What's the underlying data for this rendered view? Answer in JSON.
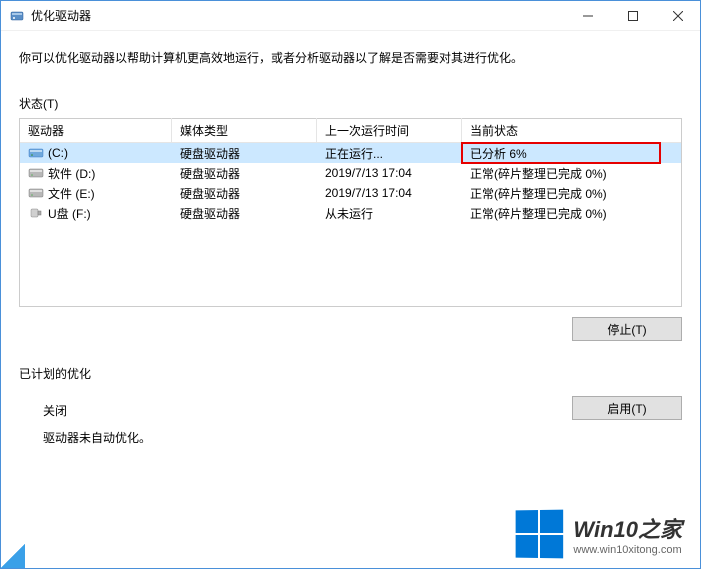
{
  "window": {
    "title": "优化驱动器"
  },
  "description": "你可以优化驱动器以帮助计算机更高效地运行，或者分析驱动器以了解是否需要对其进行优化。",
  "status": {
    "label": "状态(T)"
  },
  "columns": {
    "drive": "驱动器",
    "media": "媒体类型",
    "lastRun": "上一次运行时间",
    "state": "当前状态"
  },
  "drives": [
    {
      "icon": "disk-c",
      "name": "(C:)",
      "media": "硬盘驱动器",
      "lastRun": "正在运行...",
      "state": "已分析 6%",
      "selected": true
    },
    {
      "icon": "disk",
      "name": "软件 (D:)",
      "media": "硬盘驱动器",
      "lastRun": "2019/7/13 17:04",
      "state": "正常(碎片整理已完成 0%)",
      "selected": false
    },
    {
      "icon": "disk",
      "name": "文件 (E:)",
      "media": "硬盘驱动器",
      "lastRun": "2019/7/13 17:04",
      "state": "正常(碎片整理已完成 0%)",
      "selected": false
    },
    {
      "icon": "usb",
      "name": "U盘 (F:)",
      "media": "硬盘驱动器",
      "lastRun": "从未运行",
      "state": "正常(碎片整理已完成 0%)",
      "selected": false
    }
  ],
  "buttons": {
    "stop": "停止(T)",
    "enable": "启用(T)"
  },
  "schedule": {
    "label": "已计划的优化",
    "title": "关闭",
    "text": "驱动器未自动优化。"
  },
  "watermark": {
    "title": "Win10之家",
    "url": "www.win10xitong.com"
  }
}
